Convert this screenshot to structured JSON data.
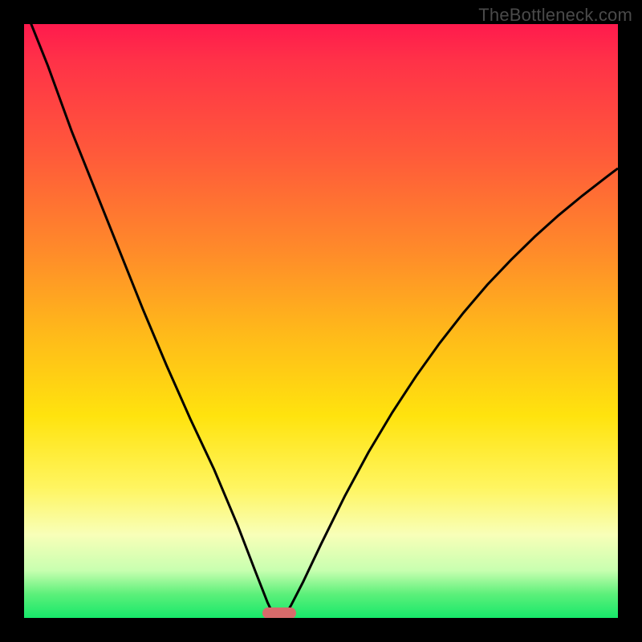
{
  "watermark": "TheBottleneck.com",
  "colors": {
    "frame": "#000000",
    "gradient_top": "#ff1a4d",
    "gradient_bottom": "#17e86a",
    "curve": "#000000",
    "marker": "#d76b6b"
  },
  "chart_data": {
    "type": "line",
    "title": "",
    "xlabel": "",
    "ylabel": "",
    "xlim": [
      0,
      100
    ],
    "ylim": [
      0,
      100
    ],
    "grid": false,
    "legend": false,
    "annotations": [],
    "marker": {
      "x_center": 43,
      "width": 5.7,
      "y": 0.8
    },
    "series": [
      {
        "name": "left-branch",
        "x": [
          0,
          4,
          8,
          12,
          16,
          20,
          24,
          28,
          32,
          36,
          39,
          41,
          42
        ],
        "y": [
          103,
          93,
          82,
          72,
          62,
          52,
          42.5,
          33.5,
          25,
          15.5,
          7.7,
          2.6,
          0.5
        ]
      },
      {
        "name": "right-branch",
        "x": [
          44,
          45,
          47,
          50,
          54,
          58,
          62,
          66,
          70,
          74,
          78,
          82,
          86,
          90,
          94,
          98,
          100
        ],
        "y": [
          0.5,
          2.2,
          6.1,
          12.4,
          20.5,
          27.9,
          34.6,
          40.7,
          46.3,
          51.4,
          56.1,
          60.3,
          64.2,
          67.8,
          71.1,
          74.2,
          75.7
        ]
      }
    ]
  }
}
